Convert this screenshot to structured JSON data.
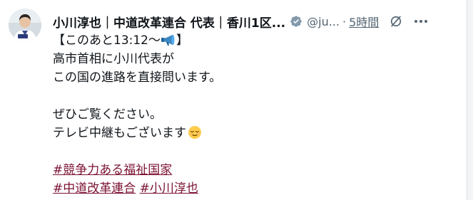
{
  "author": {
    "name": "小川淳也｜中道改革連合 代表｜香川1区...",
    "handle": "@ju...",
    "separator": "·",
    "time": "5時間"
  },
  "tweet": {
    "line1_prefix": "【このあと13:12〜",
    "line1_suffix": "】",
    "line2": "高市首相に小川代表が",
    "line3": "この国の進路を直接問います。",
    "line4": "ぜひご覧ください。",
    "line5": "テレビ中継もございます",
    "hashtag1": "#競争力ある福祉国家",
    "hashtag2": "#中道改革連合",
    "hashtag3": "#小川淳也"
  },
  "icons": {
    "verified": "verified-badge-icon",
    "grok": "grok-icon",
    "more": "more-dots-icon",
    "megaphone": "megaphone-emoji",
    "relieved": "relieved-face-emoji"
  },
  "colors": {
    "text": "#0f1419",
    "muted": "#536471",
    "hashtag": "#7b1232",
    "verified": "#829aab"
  }
}
